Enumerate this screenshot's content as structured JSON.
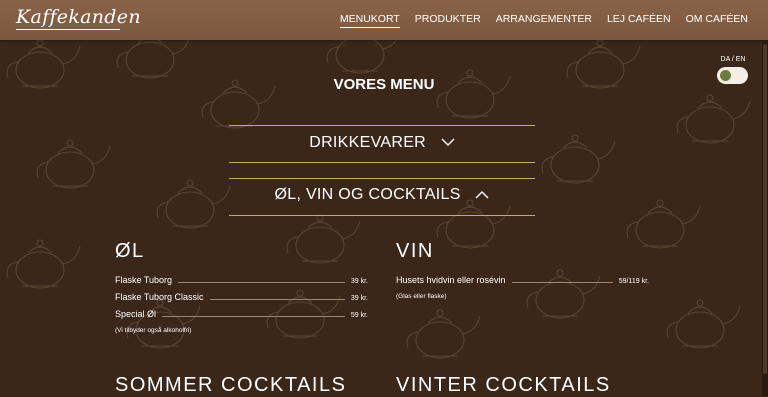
{
  "header": {
    "logo": "Kaffekanden",
    "nav": [
      "MENUKORT",
      "PRODUKTER",
      "ARRANGEMENTER",
      "LEJ CAFÉEN",
      "OM CAFÉEN"
    ],
    "active": "MENUKORT"
  },
  "language_toggle": {
    "label": "DA / EN",
    "selected": "DA"
  },
  "main": {
    "title": "VORES MENU",
    "accordions": [
      {
        "label": "DRIKKEVARER",
        "expanded": false
      },
      {
        "label": "ØL, VIN OG COCKTAILS",
        "expanded": true
      }
    ],
    "beer": {
      "title": "ØL",
      "items": [
        {
          "name": "Flaske Tuborg",
          "price": "39 kr."
        },
        {
          "name": "Flaske Tuborg Classic",
          "price": "39 kr."
        },
        {
          "name": "Special Øl",
          "price": "59 kr."
        }
      ],
      "note": "(Vi tilbyder også alkoholfri)"
    },
    "wine": {
      "title": "VIN",
      "items": [
        {
          "name": "Husets hvidvin eller rosévin",
          "price": "59/119 kr."
        }
      ],
      "note": "(Glas eller flaske)"
    },
    "summer_cocktails": {
      "title": "SOMMER COCKTAILS"
    },
    "winter_cocktails": {
      "title": "VINTER COCKTAILS"
    }
  },
  "colors": {
    "background": "#3a271a",
    "header": "#7b5840",
    "accent_line": "#c8ad67",
    "toggle_knob": "#6f7b3e"
  }
}
